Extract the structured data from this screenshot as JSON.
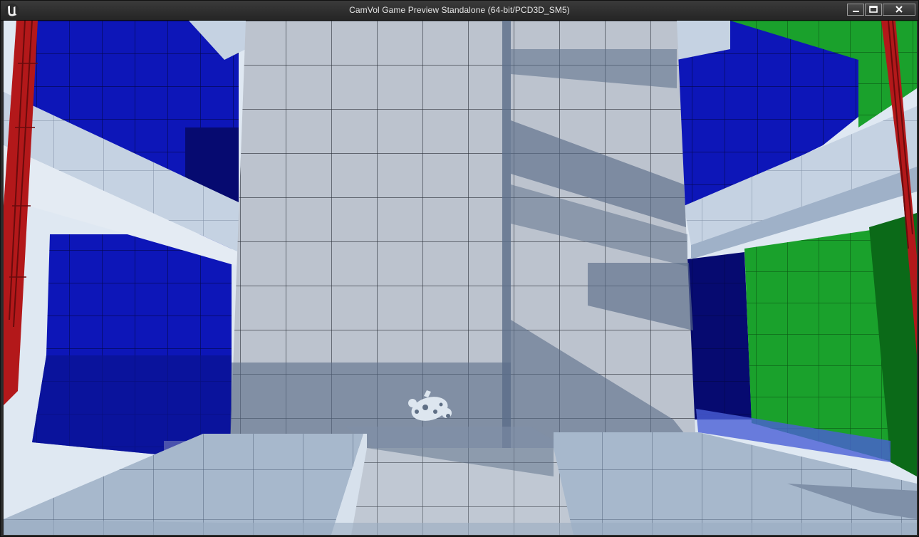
{
  "window": {
    "title": "CamVol Game Preview Standalone (64-bit/PCD3D_SM5)",
    "logo_icon": "unreal-engine-logo",
    "controls": [
      "minimize-icon",
      "maximize-icon",
      "close-icon"
    ]
  },
  "viewport": {
    "scene": "game-viewport",
    "colors": {
      "floor": "#b9c0cc",
      "shadow": "#5a6d88",
      "sky": "#dfe8f2",
      "blue_block": "#0d16b8",
      "dark_blue": "#060a70",
      "green_block": "#1aa12c",
      "red_pillar": "#b3181a",
      "ledge": "#c2d0e0"
    }
  }
}
